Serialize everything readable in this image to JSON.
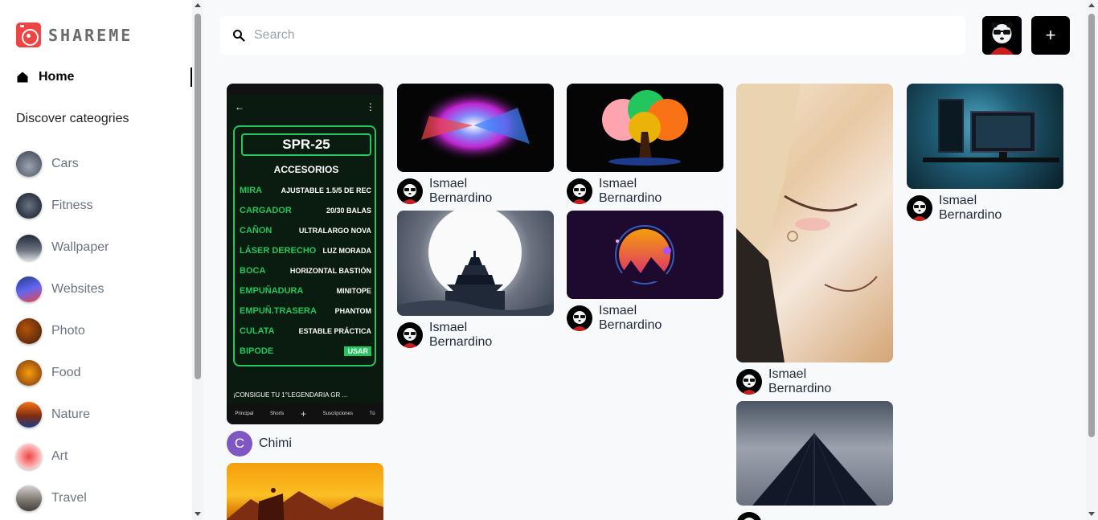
{
  "app": {
    "name": "SHAREME"
  },
  "nav": {
    "home_label": "Home",
    "discover_label": "Discover cateogries"
  },
  "categories": [
    {
      "label": "Cars",
      "color": "#6b7280"
    },
    {
      "label": "Fitness",
      "color": "#374151"
    },
    {
      "label": "Wallpaper",
      "color": "#4b5563"
    },
    {
      "label": "Websites",
      "color": "#3b5ba5"
    },
    {
      "label": "Photo",
      "color": "#7c4a2d"
    },
    {
      "label": "Food",
      "color": "#a16207"
    },
    {
      "label": "Nature",
      "color": "#c2410c"
    },
    {
      "label": "Art",
      "color": "#dc2626"
    },
    {
      "label": "Travel",
      "color": "#78716c"
    }
  ],
  "search": {
    "placeholder": "Search",
    "value": ""
  },
  "header": {
    "add_label": "+"
  },
  "pins": [
    {
      "author": "Chimi",
      "author_initial": "C"
    },
    {
      "author": "Ismael Bernardino"
    },
    {
      "author": "Ismael Bernardino"
    },
    {
      "author": "Ismael Bernardino"
    },
    {
      "author": "Ismael Bernardino"
    },
    {
      "author": "Ismael Bernardino"
    },
    {
      "author": "Ismael Bernardino"
    }
  ],
  "phone_shot": {
    "title": "SPR-25",
    "subtitle": "ACCESORIOS",
    "rows": [
      {
        "k": "MIRA",
        "v": "AJUSTABLE 1.5/5 DE REC"
      },
      {
        "k": "CARGADOR",
        "v": "20/30 BALAS"
      },
      {
        "k": "CAÑON",
        "v": "ULTRALARGO NOVA"
      },
      {
        "k": "LÁSER DERECHO",
        "v": "LUZ MORADA"
      },
      {
        "k": "BOCA",
        "v": "HORIZONTAL BASTIÓN"
      },
      {
        "k": "EMPUÑADURA",
        "v": "MINITOPE"
      },
      {
        "k": "EMPUÑ.TRASERA",
        "v": "PHANTOM"
      },
      {
        "k": "CULATA",
        "v": "ESTABLE PRÁCTICA"
      },
      {
        "k": "BIPODE",
        "v": "USAR"
      }
    ],
    "caption": "¡CONSIGUE TU 1°LEGENDARIA GR ...",
    "tabs": [
      "Principal",
      "Shorts",
      "+",
      "Suscripciones",
      "Tú"
    ]
  },
  "colors": {
    "accent": "#ef4444",
    "sidebar_bg": "#ffffff",
    "page_bg": "#f8f9fb"
  }
}
